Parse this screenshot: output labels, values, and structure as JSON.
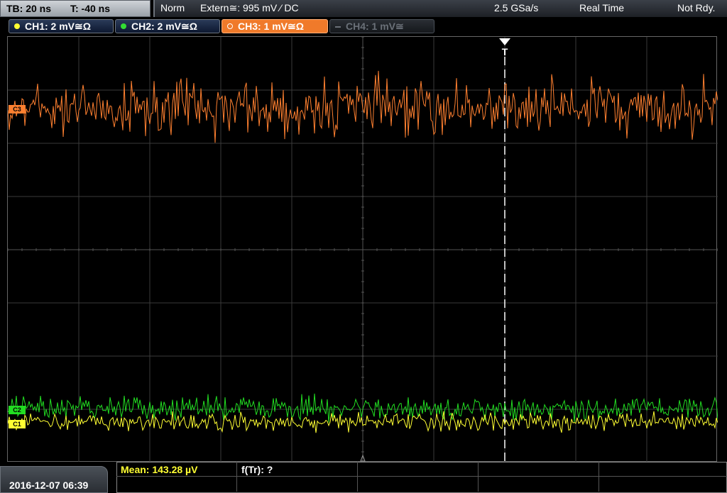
{
  "topbar": {
    "timebase": "TB: 20 ns",
    "trigger_time": "T: -40 ns",
    "mode": "Norm",
    "trigger_source": "Extern≅: 995 mV ⁄ DC",
    "sample_rate": "2.5 GSa/s",
    "acq_mode": "Real Time",
    "state": "Not Rdy."
  },
  "channels": [
    {
      "label": "CH1: 2 mV≅Ω",
      "color": "#ffff33",
      "state": "on"
    },
    {
      "label": "CH2: 2 mV≅Ω",
      "color": "#33dd33",
      "state": "on"
    },
    {
      "label": "CH3: 1 mV≅Ω",
      "color": "#ff8c2a",
      "state": "active"
    },
    {
      "label": "CH4: 1 mV≅",
      "color": "#6a7078",
      "state": "off"
    }
  ],
  "markers": {
    "ch3": "C3",
    "ch2": "C2",
    "ch1": "C1",
    "trigger": "T"
  },
  "bottombar": {
    "datetime": "2016-12-07 06:39",
    "mean": "Mean: 143.28 µV",
    "ftr": "f(Tr): ?"
  },
  "colors": {
    "ch1": "#ffff33",
    "ch2": "#22dd22",
    "ch3": "#ff8030",
    "grid": "#3a3a3a",
    "trigger_line": "#ffffff"
  }
}
